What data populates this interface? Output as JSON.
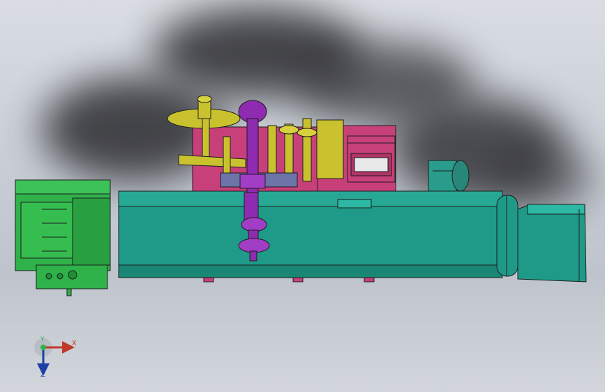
{
  "view": {
    "triad": {
      "x_label": "X",
      "y_label": "Y",
      "z_label": "Z"
    }
  },
  "colors": {
    "conveyor": "#1f9a88",
    "feeder": "#2fb24a",
    "labeler": "#c9c22e",
    "spindle": "#8e2bb0",
    "frame": "#c8407a",
    "motor": "#2a9c8c",
    "background": "#c9ced6"
  }
}
